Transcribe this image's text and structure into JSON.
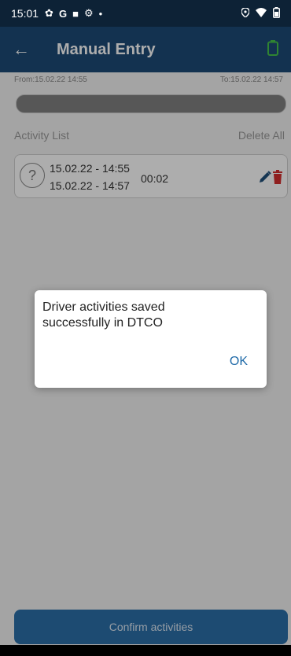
{
  "status": {
    "time": "15:01"
  },
  "header": {
    "title": "Manual Entry",
    "back_icon": "←"
  },
  "range": {
    "from": "From:15.02.22 14:55",
    "to": "To:15.02.22 14:57"
  },
  "list": {
    "title": "Activity List",
    "delete_all": "Delete All"
  },
  "activities": [
    {
      "type_icon": "?",
      "start": "15.02.22 - 14:55",
      "end": "15.02.22 - 14:57",
      "duration": "00:02"
    }
  ],
  "footer": {
    "confirm_label": "Confirm activities"
  },
  "dialog": {
    "message": "Driver activities saved successfully in DTCO",
    "ok_label": "OK"
  },
  "colors": {
    "app_bar": "#1c4b77",
    "accent": "#1f6aa8",
    "delete": "#d32f2f",
    "battery": "#46c34a"
  }
}
